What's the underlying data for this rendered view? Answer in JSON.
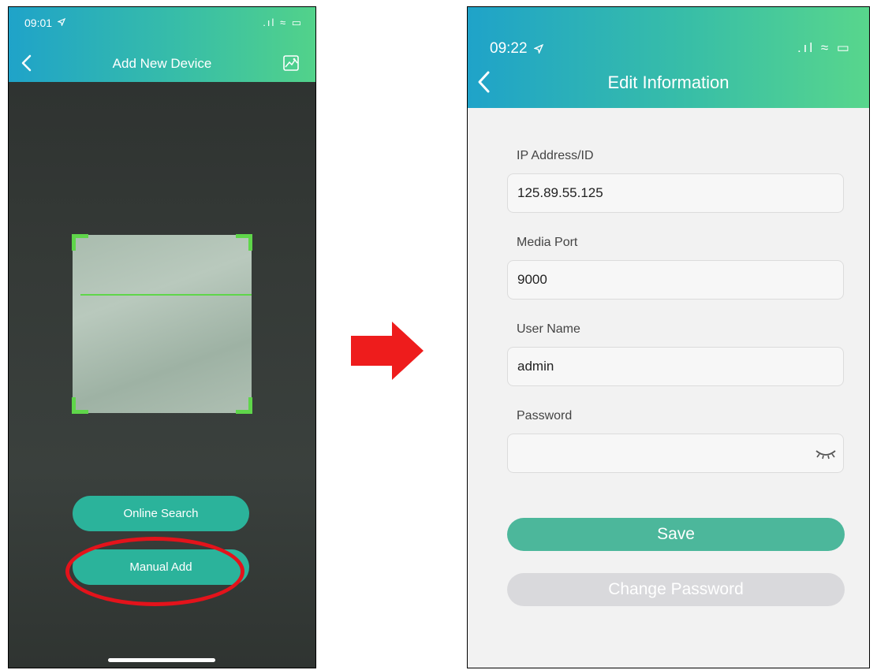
{
  "left_screen": {
    "status_time": "09:01",
    "status_icons": ".ıl ≈ ▭",
    "title": "Add New Device",
    "online_search_label": "Online Search",
    "manual_add_label": "Manual Add"
  },
  "right_screen": {
    "status_time": "09:22",
    "status_icons": ".ıl ≈ ▭",
    "title": "Edit Information",
    "fields": [
      {
        "label": "IP Address/ID",
        "value": "125.89.55.125"
      },
      {
        "label": "Media Port",
        "value": "9000"
      },
      {
        "label": "User Name",
        "value": "admin"
      },
      {
        "label": "Password",
        "value": ""
      }
    ],
    "save_label": "Save",
    "change_password_label": "Change Password"
  },
  "colors": {
    "accent_teal": "#2bb39b",
    "highlight_red": "#e3131b",
    "scan_green": "#5fd64a"
  },
  "icons": [
    "back-chevron-icon",
    "gallery-icon",
    "location-arrow-icon",
    "signal-icon",
    "wifi-icon",
    "battery-icon",
    "eye-closed-icon",
    "red-arrow-icon"
  ]
}
